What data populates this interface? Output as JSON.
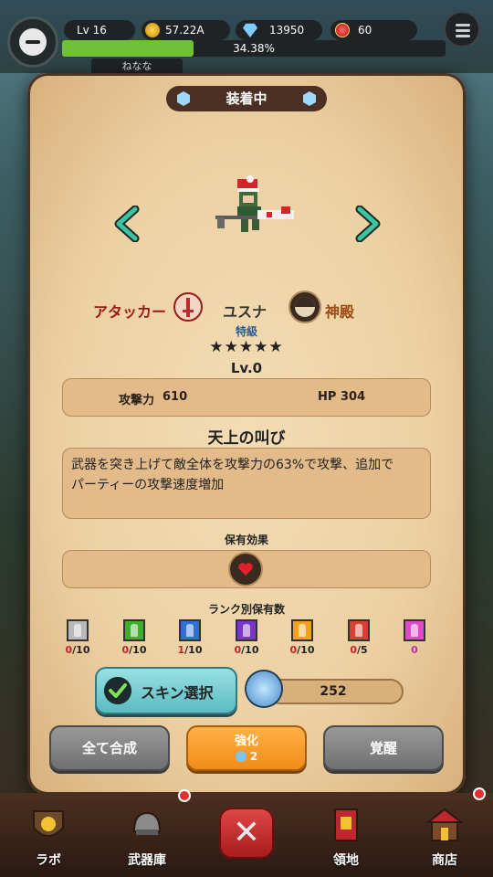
{
  "hud": {
    "level": "Lv 16",
    "gold": "57.22A",
    "gems": "13950",
    "rubies": "60",
    "xp_percent_text": "34.38%",
    "xp_progress": 0.3438,
    "player_name": "ねなな"
  },
  "dialog": {
    "title": "装着中",
    "hero": {
      "role": "アタッカー",
      "name": "ユスナ",
      "faction": "神殿",
      "rank": "特級",
      "stars": "★★★★★",
      "level": "Lv.0",
      "attack_label": "攻撃力",
      "attack_value": "610",
      "hp_label": "HP",
      "hp_value": "304"
    },
    "skill": {
      "name": "天上の叫び",
      "description_line1": "武器を突き上げて敵全体を攻撃力の63%で攻撃、追加で",
      "description_line2": "パーティーの攻撃速度増加"
    },
    "owned_effect_label": "保有効果",
    "rank_owned_label": "ランク別保有数",
    "rank_counts": [
      {
        "owned": "0",
        "max": "/10",
        "color": "#b9b9b9"
      },
      {
        "owned": "0",
        "max": "/10",
        "color": "#3fae2f"
      },
      {
        "owned": "1",
        "max": "/10",
        "color": "#2f6fd6"
      },
      {
        "owned": "0",
        "max": "/10",
        "color": "#7a34c8"
      },
      {
        "owned": "0",
        "max": "/10",
        "color": "#f0a020"
      },
      {
        "owned": "0",
        "max": "/5",
        "color": "#d8412f"
      },
      {
        "owned": "0",
        "max": "",
        "color": "#e249c6"
      }
    ],
    "skin_select_label": "スキン選択",
    "fragment_count": "252",
    "buttons": {
      "merge_all": "全て合成",
      "enhance": "強化",
      "enhance_cost": "2",
      "awaken": "覚醒"
    }
  },
  "bottom_nav": {
    "items": [
      "ラボ",
      "武器庫",
      "領地",
      "商店"
    ]
  },
  "colors": {
    "accent_green": "#2fb89a",
    "role_red": "#9a1a1a",
    "faction_brown": "#9a4a12"
  }
}
